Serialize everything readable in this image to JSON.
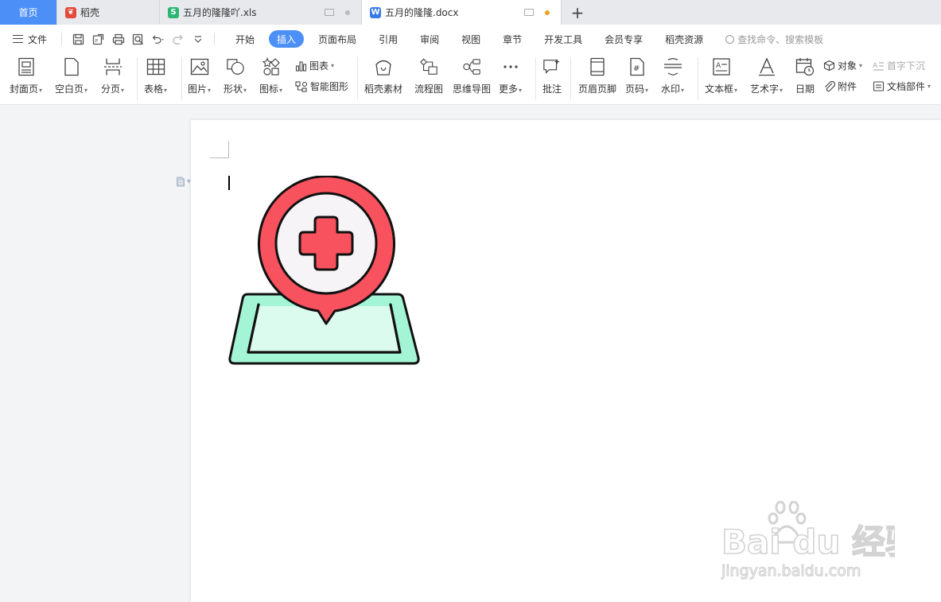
{
  "tabs": {
    "home": "首页",
    "daoke": "稻壳",
    "xls": "五月的隆隆吖.xls",
    "docx": "五月的隆隆.docx"
  },
  "menubar": {
    "file_label": "文件",
    "items": [
      "开始",
      "插入",
      "页面布局",
      "引用",
      "审阅",
      "视图",
      "章节",
      "开发工具",
      "会员专享",
      "稻壳资源"
    ],
    "active_item": "插入",
    "search_placeholder": "查找命令、搜索模板"
  },
  "ribbon": {
    "cover": "封面页",
    "blank": "空白页",
    "pagebreak": "分页",
    "table": "表格",
    "picture": "图片",
    "shape": "形状",
    "iconlib": "图标",
    "chart": "图表",
    "smartart": "智能图形",
    "daoke_material": "稻壳素材",
    "flowchart": "流程图",
    "mindmap": "思维导图",
    "more": "更多",
    "comment": "批注",
    "header_footer": "页眉页脚",
    "page_number": "页码",
    "watermark": "水印",
    "textbox": "文本框",
    "wordart": "艺术字",
    "date": "日期",
    "object": "对象",
    "attachment": "附件",
    "dropcap": "首字下沉",
    "doc_parts": "文档部件"
  },
  "watermark_text": {
    "brand": "Bai du 经验",
    "url": "jingyan.baidu.com"
  },
  "colors": {
    "accent": "#4c8ff7",
    "pin_red": "#f7525e",
    "map_green": "#a4f5d6",
    "map_green_light": "#dcfbef"
  }
}
